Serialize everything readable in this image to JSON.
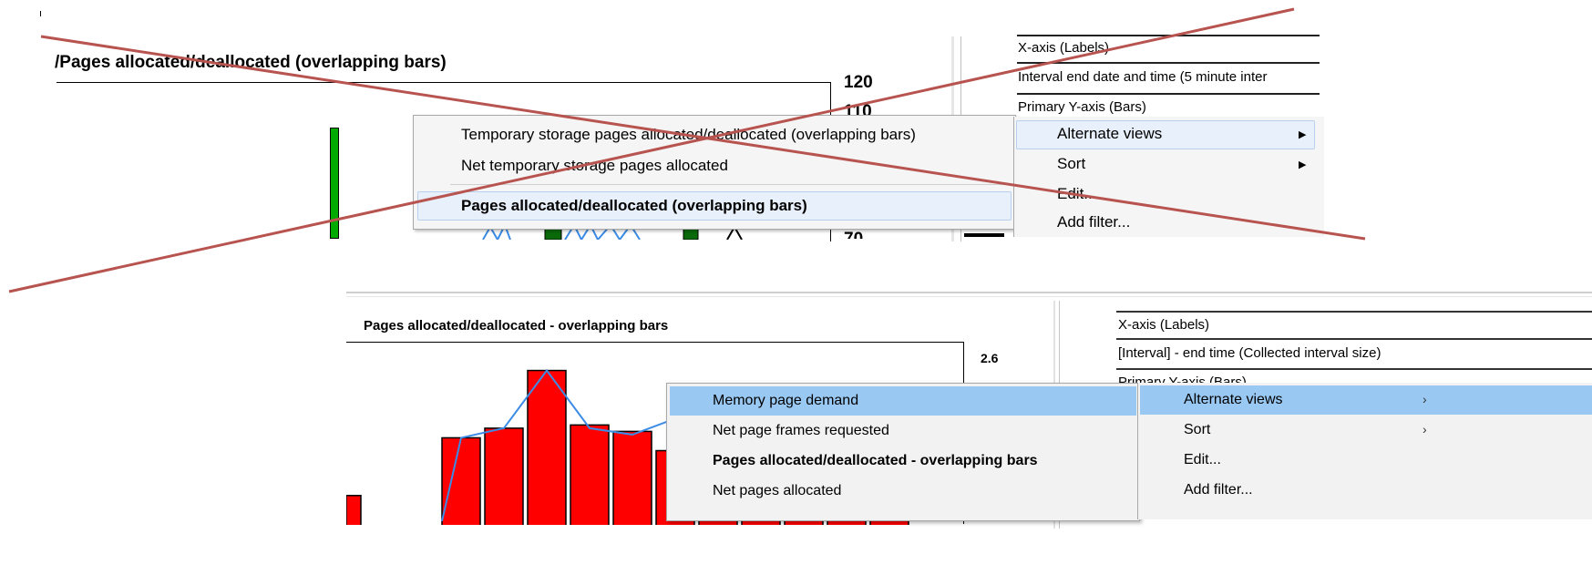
{
  "top": {
    "chart_title": "/Pages allocated/deallocated (overlapping bars)",
    "y_ticks": [
      "120",
      "110",
      "70"
    ],
    "properties": {
      "x_axis_header": "X-axis (Labels)",
      "x_axis_value": "Interval end date and time (5 minute inter",
      "primary_y_header": "Primary Y-axis (Bars)"
    },
    "menu": {
      "items": [
        "Temporary storage pages allocated/deallocated (overlapping bars)",
        "Net temporary storage pages allocated"
      ],
      "selected_item": "Pages allocated/deallocated (overlapping bars)"
    },
    "context_menu": {
      "items": [
        "Alternate views",
        "Sort",
        "Edit...",
        "Add filter..."
      ],
      "submenu_arrow": "▶"
    },
    "crossed_out": true,
    "cross_color": "#b85450"
  },
  "bottom": {
    "chart_title": "Pages allocated/deallocated - overlapping bars",
    "y_tick": "2.6",
    "properties": {
      "x_axis_header": "X-axis (Labels)",
      "x_axis_value": "[Interval] - end time (Collected interval size)",
      "primary_y_header": "Primary Y-axis (Bars)"
    },
    "menu": {
      "items": [
        "Memory page demand",
        "Net page frames requested",
        "Pages allocated/deallocated - overlapping bars",
        "Net pages allocated"
      ],
      "highlighted_index": 0,
      "bold_index": 2
    },
    "context_menu": {
      "items": [
        "Alternate views",
        "Sort",
        "Edit...",
        "Add filter..."
      ],
      "submenu_arrow": "›"
    },
    "bar_color": "#ff0000",
    "line_color": "#3c8ce6",
    "highlight_color": "#99c9f3"
  },
  "chart_data": {
    "type": "bar",
    "values": [
      0.6,
      1.5,
      1.65,
      2.55,
      1.7,
      1.6,
      1.3,
      1.3,
      1.3,
      1.3,
      1.3,
      1.3
    ],
    "line_values": [
      0.2,
      1.5,
      1.65,
      2.55,
      1.65,
      1.55,
      1.8,
      1.3,
      1.2,
      1.3,
      1.2,
      0.6
    ],
    "ylim": [
      0,
      2.7
    ]
  }
}
